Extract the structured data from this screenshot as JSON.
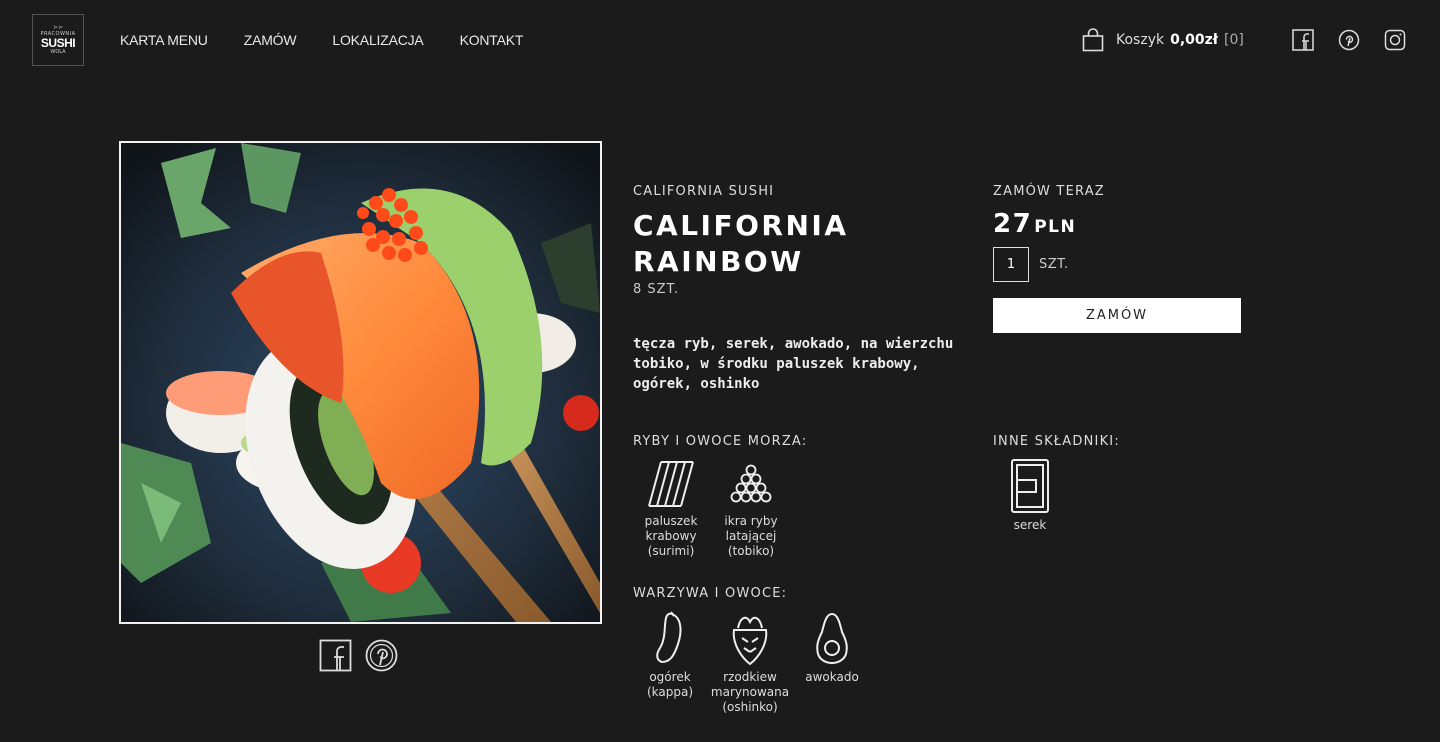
{
  "header": {
    "logo": {
      "top": "PRACOWNIA",
      "main": "SUSHI",
      "bottom": "WOLA"
    },
    "nav": [
      "KARTA MENU",
      "ZAMÓW",
      "LOKALIZACJA",
      "KONTAKT"
    ],
    "cart": {
      "label": "Koszyk",
      "amount": "0,00zł",
      "count": "[0]"
    },
    "social_icons": [
      "facebook-icon",
      "pinterest-icon",
      "instagram-icon"
    ]
  },
  "product": {
    "category": "CALIFORNIA SUSHI",
    "title": "CALIFORNIA RAINBOW",
    "pieces": "8 SZT.",
    "description": "tęcza ryb, serek, awokado, na wierzchu tobiko, w środku paluszek krabowy, ogórek, oshinko"
  },
  "order": {
    "label": "ZAMÓW TERAZ",
    "price": "27",
    "currency": "PLN",
    "quantity": "1",
    "unit": "SZT.",
    "button": "ZAMÓW"
  },
  "sections": {
    "seafood": {
      "label": "RYBY I OWOCE MORZA:",
      "items": [
        {
          "name": "paluszek krabowy (surimi)",
          "icon": "crab-stick-icon"
        },
        {
          "name": "ikra ryby latającej (tobiko)",
          "icon": "fish-roe-icon"
        }
      ]
    },
    "other": {
      "label": "INNE SKŁADNIKI:",
      "items": [
        {
          "name": "serek",
          "icon": "cheese-icon"
        }
      ]
    },
    "veggies": {
      "label": "WARZYWA I OWOCE:",
      "items": [
        {
          "name": "ogórek (kappa)",
          "icon": "cucumber-icon"
        },
        {
          "name": "rzodkiew marynowana (oshinko)",
          "icon": "radish-icon"
        },
        {
          "name": "awokado",
          "icon": "avocado-icon"
        }
      ]
    }
  },
  "share_icons": [
    "facebook-icon",
    "pinterest-icon"
  ]
}
